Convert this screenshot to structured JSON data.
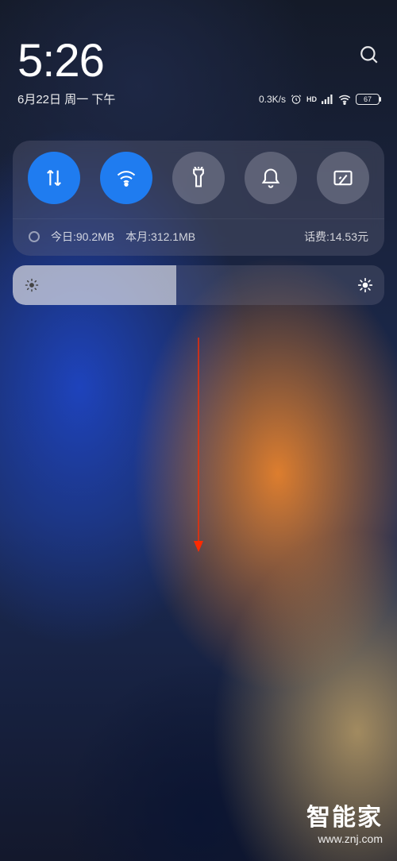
{
  "header": {
    "time": "5:26",
    "date": "6月22日 周一 下午"
  },
  "status": {
    "speed": "0.3K/s",
    "hd_label": "HD",
    "battery": "67"
  },
  "toggles": [
    {
      "name": "mobile-data",
      "active": true
    },
    {
      "name": "wifi",
      "active": true
    },
    {
      "name": "flashlight",
      "active": false
    },
    {
      "name": "bell",
      "active": false
    },
    {
      "name": "screenshot",
      "active": false
    }
  ],
  "data_usage": {
    "today_label": "今日:90.2MB",
    "month_label": "本月:312.1MB",
    "balance_label": "话费:14.53元"
  },
  "brightness": {
    "percent": 44
  },
  "watermark": {
    "title": "智能家",
    "url": "www.znj.com"
  }
}
